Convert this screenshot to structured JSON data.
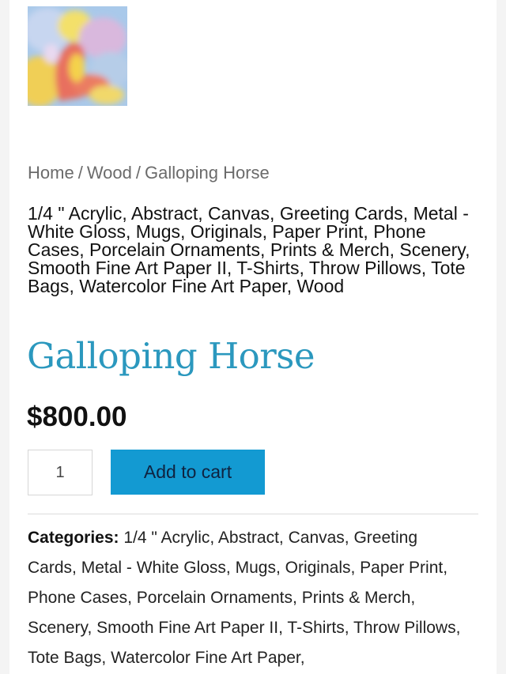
{
  "product_image": {
    "alt": "Galloping Horse painting thumbnail",
    "colors": [
      "#9fc6ea",
      "#f0d24a",
      "#e86a5a",
      "#d8b3d8"
    ]
  },
  "breadcrumb": {
    "items": [
      "Home",
      "Wood",
      "Galloping Horse"
    ],
    "separator": "/"
  },
  "tags": [
    "1/4 \" Acrylic",
    "Abstract",
    "Canvas",
    "Greeting Cards",
    "Metal - White Gloss",
    "Mugs",
    "Originals",
    "Paper Print",
    "Phone Cases",
    "Porcelain Ornaments",
    "Prints & Merch",
    "Scenery",
    "Smooth Fine Art Paper II",
    "T-Shirts",
    "Throw Pillows",
    "Tote Bags",
    "Watercolor Fine Art Paper",
    "Wood"
  ],
  "product": {
    "title": "Galloping Horse",
    "price": "$800.00",
    "title_color": "#2b98be"
  },
  "cart": {
    "quantity": "1",
    "add_label": "Add to cart",
    "button_color": "#139ad2"
  },
  "meta": {
    "categories_label": "Categories:",
    "categories": [
      "1/4 \" Acrylic",
      "Abstract",
      "Canvas",
      "Greeting Cards",
      "Metal - White Gloss",
      "Mugs",
      "Originals",
      "Paper Print",
      "Phone Cases",
      "Porcelain Ornaments",
      "Prints & Merch",
      "Scenery",
      "Smooth Fine Art Paper II",
      "T-Shirts",
      "Throw Pillows",
      "Tote Bags",
      "Watercolor Fine Art Paper"
    ]
  }
}
